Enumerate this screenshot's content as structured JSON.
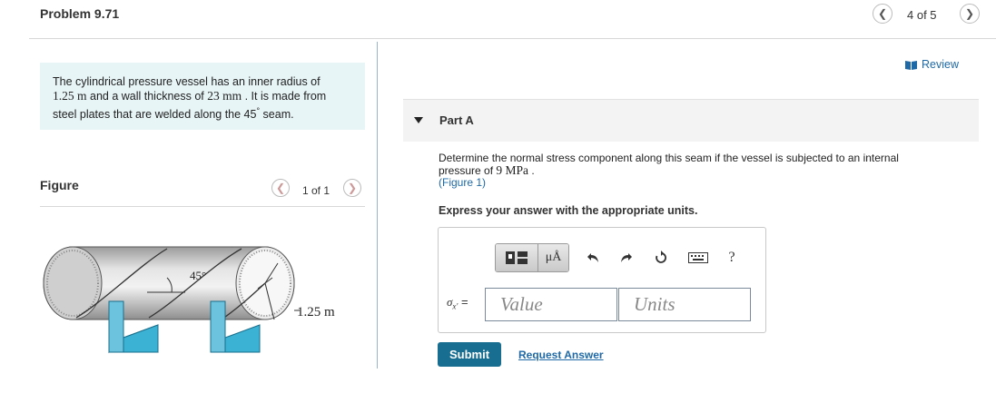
{
  "header": {
    "title": "Problem 9.71",
    "pager": "4 of 5",
    "prev_icon": "chevron-left-icon",
    "next_icon": "chevron-right-icon"
  },
  "problem": {
    "text_1": "The cylindrical pressure vessel has an inner radius of",
    "radius": "1.25 m",
    "text_2": " and a wall thickness of ",
    "thickness": "23 mm",
    "text_3": " . It is made from",
    "text_4": "steel plates that are welded along the 45",
    "degree": "°",
    "text_5": " seam."
  },
  "figure": {
    "label": "Figure",
    "pager": "1 of 1",
    "angle_label": "45°",
    "radius_label": "1.25 m"
  },
  "review": {
    "label": "Review",
    "icon": "book-icon"
  },
  "part": {
    "title": "Part A",
    "question_1": "Determine the normal stress component along this seam if the vessel is subjected to an internal",
    "question_2": "pressure of ",
    "pressure": "9 MPa",
    "question_3": " .",
    "figure_link": "(Figure 1)",
    "instruction": "Express your answer with the appropriate units."
  },
  "toolbar": {
    "units_symbol": "μÅ",
    "help": "?",
    "icons": [
      "templates-icon",
      "units-icon",
      "undo-icon",
      "redo-icon",
      "reset-icon",
      "keyboard-icon",
      "help-icon"
    ]
  },
  "answer": {
    "variable": "σ",
    "subscript": "x'",
    "equals": " =",
    "value_placeholder": "Value",
    "units_placeholder": "Units"
  },
  "actions": {
    "submit": "Submit",
    "request": "Request Answer"
  },
  "colors": {
    "accent": "#176e91",
    "link": "#1f6aa6",
    "problem_bg": "#e8f5f7",
    "support": "#2aa3c9"
  }
}
